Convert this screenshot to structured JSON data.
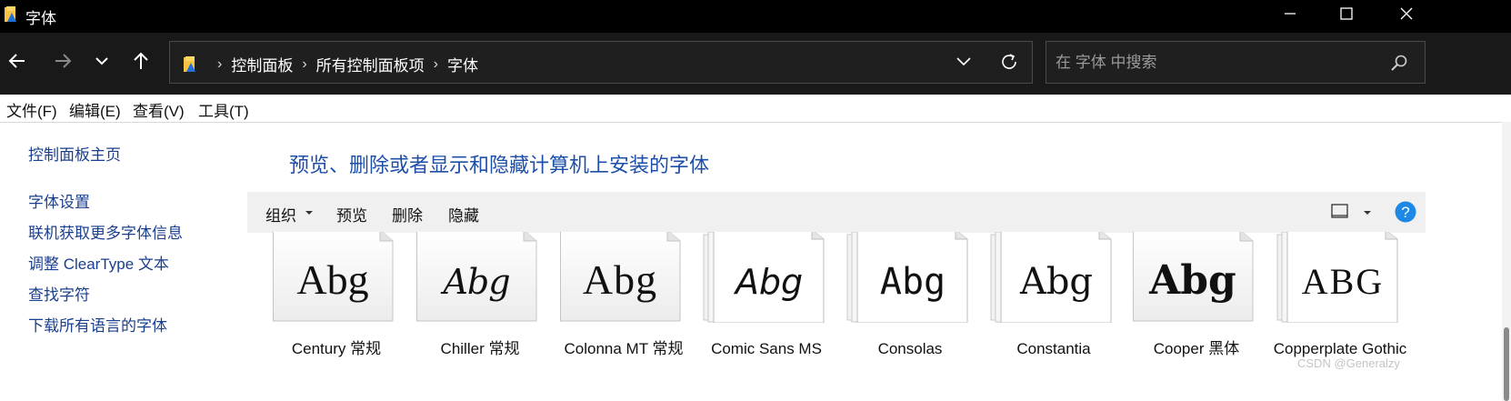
{
  "window": {
    "title": "字体"
  },
  "nav": {
    "back_icon": "arrow-left-icon",
    "forward_icon": "arrow-right-icon",
    "recent_icon": "chevron-down-icon",
    "up_icon": "arrow-up-icon"
  },
  "address": {
    "crumbs": [
      "控制面板",
      "所有控制面板项",
      "字体"
    ],
    "separator": "›",
    "refresh_icon": "refresh-icon"
  },
  "search": {
    "placeholder": "在 字体 中搜索"
  },
  "menubar": {
    "items": [
      "文件(F)",
      "编辑(E)",
      "查看(V)",
      "工具(T)"
    ]
  },
  "sidebar": {
    "home": "控制面板主页",
    "links": [
      "字体设置",
      "联机获取更多字体信息",
      "调整 ClearType 文本",
      "查找字符",
      "下载所有语言的字体"
    ]
  },
  "main": {
    "heading": "预览、删除或者显示和隐藏计算机上安装的字体"
  },
  "commands": {
    "organize": "组织",
    "preview": "预览",
    "delete": "删除",
    "hide": "隐藏",
    "help": "?"
  },
  "fonts": [
    {
      "name": "Century 常规",
      "sample": "Abg",
      "stack": false
    },
    {
      "name": "Chiller 常规",
      "sample": "Abg",
      "stack": false
    },
    {
      "name": "Colonna MT 常规",
      "sample": "Abg",
      "stack": false
    },
    {
      "name": "Comic Sans MS",
      "sample": "Abg",
      "stack": true
    },
    {
      "name": "Consolas",
      "sample": "Abg",
      "stack": true
    },
    {
      "name": "Constantia",
      "sample": "Abg",
      "stack": true
    },
    {
      "name": "Cooper 黑体",
      "sample": "Abg",
      "stack": false
    },
    {
      "name": "Copperplate Gothic",
      "sample": "ABG",
      "stack": true
    }
  ],
  "watermark": "CSDN @Generalzy",
  "colors": {
    "link": "#1a3f8f",
    "heading": "#1e4fa8",
    "help": "#1e88e5"
  }
}
